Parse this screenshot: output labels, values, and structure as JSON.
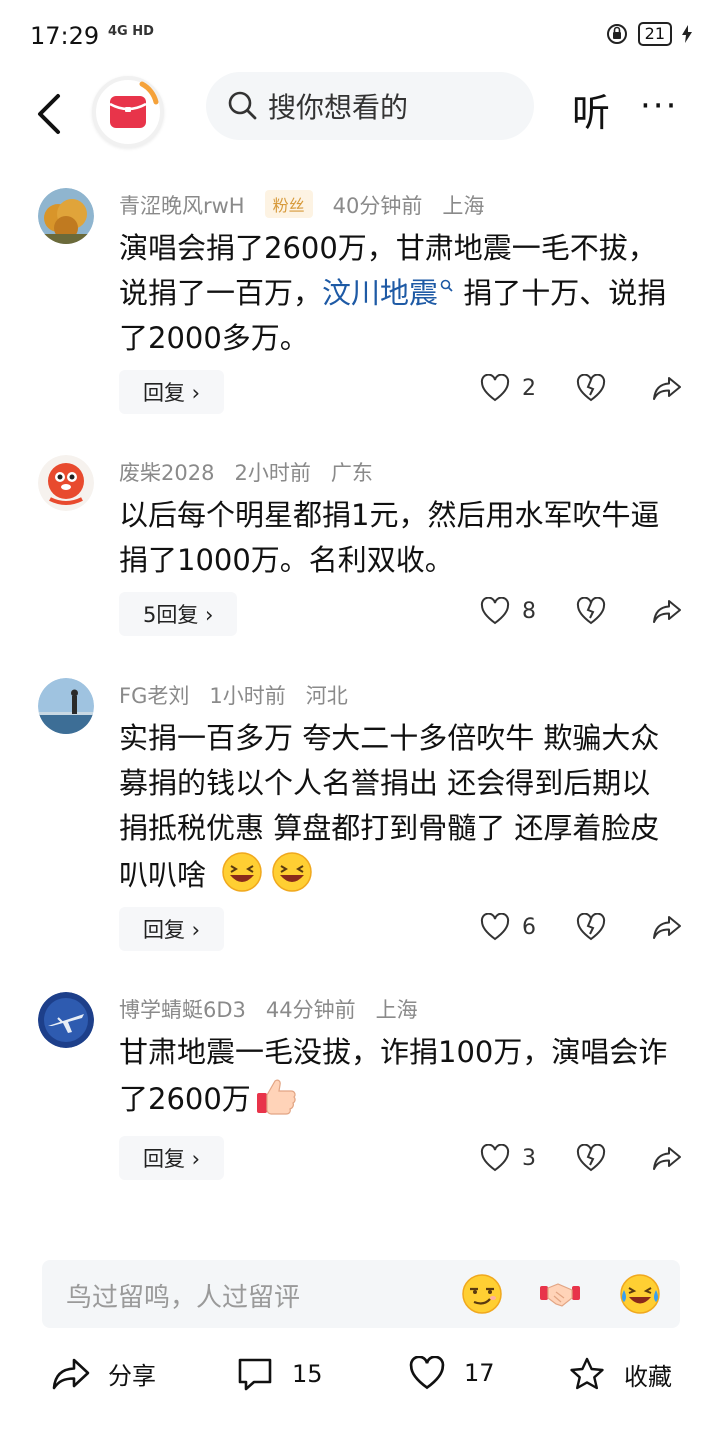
{
  "status": {
    "time": "17:29",
    "network": "4G HD",
    "battery": "21"
  },
  "header": {
    "search_placeholder": "搜你想看的",
    "listen_label": "听",
    "more_label": "···"
  },
  "comments": [
    {
      "user": "青涩晚风rwH",
      "badge": "粉丝",
      "time": "40分钟前",
      "location": "上海",
      "text_before": "演唱会捐了2600万，甘肃地震一毛不拔，说捐了一百万，",
      "topic": "汶川地震",
      "text_after": " 捐了十万、说捐了2000多万。",
      "reply_label": "回复 ›",
      "likes": "2"
    },
    {
      "user": "废柴2028",
      "time": "2小时前",
      "location": "广东",
      "text": "以后每个明星都捐1元，然后用水军吹牛逼捐了1000万。名利双收。",
      "reply_label": "5回复 ›",
      "likes": "8"
    },
    {
      "user": "FG老刘",
      "time": "1小时前",
      "location": "河北",
      "text": "实捐一百多万 夸大二十多倍吹牛 欺骗大众 募捐的钱以个人名誉捐出 还会得到后期以捐抵税优惠 算盘都打到骨髓了 还厚着脸皮叭叭啥 ",
      "reply_label": "回复 ›",
      "likes": "6"
    },
    {
      "user": "博学蜻蜓6D3",
      "time": "44分钟前",
      "location": "上海",
      "text": "甘肃地震一毛没拔，诈捐100万，演唱会诈了2600万",
      "reply_label": "回复 ›",
      "likes": "3"
    }
  ],
  "input": {
    "placeholder": "鸟过留鸣，人过留评"
  },
  "bottom": {
    "share": "分享",
    "comments": "15",
    "likes": "17",
    "favorite": "收藏"
  },
  "colors": {
    "link": "#1e5aa5",
    "brand_red": "#e8344a",
    "badge_text": "#d79a3b",
    "meta": "#8a8a8a"
  }
}
